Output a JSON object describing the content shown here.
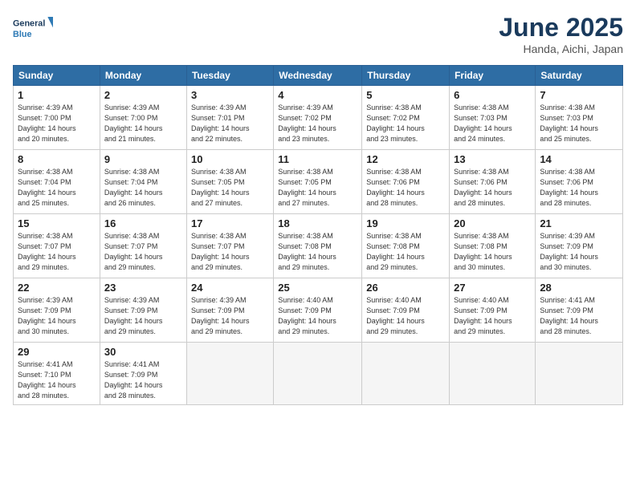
{
  "logo": {
    "line1": "General",
    "line2": "Blue"
  },
  "title": "June 2025",
  "location": "Handa, Aichi, Japan",
  "weekdays": [
    "Sunday",
    "Monday",
    "Tuesday",
    "Wednesday",
    "Thursday",
    "Friday",
    "Saturday"
  ],
  "weeks": [
    [
      {
        "day": "1",
        "info": "Sunrise: 4:39 AM\nSunset: 7:00 PM\nDaylight: 14 hours\nand 20 minutes."
      },
      {
        "day": "2",
        "info": "Sunrise: 4:39 AM\nSunset: 7:00 PM\nDaylight: 14 hours\nand 21 minutes."
      },
      {
        "day": "3",
        "info": "Sunrise: 4:39 AM\nSunset: 7:01 PM\nDaylight: 14 hours\nand 22 minutes."
      },
      {
        "day": "4",
        "info": "Sunrise: 4:39 AM\nSunset: 7:02 PM\nDaylight: 14 hours\nand 23 minutes."
      },
      {
        "day": "5",
        "info": "Sunrise: 4:38 AM\nSunset: 7:02 PM\nDaylight: 14 hours\nand 23 minutes."
      },
      {
        "day": "6",
        "info": "Sunrise: 4:38 AM\nSunset: 7:03 PM\nDaylight: 14 hours\nand 24 minutes."
      },
      {
        "day": "7",
        "info": "Sunrise: 4:38 AM\nSunset: 7:03 PM\nDaylight: 14 hours\nand 25 minutes."
      }
    ],
    [
      {
        "day": "8",
        "info": "Sunrise: 4:38 AM\nSunset: 7:04 PM\nDaylight: 14 hours\nand 25 minutes."
      },
      {
        "day": "9",
        "info": "Sunrise: 4:38 AM\nSunset: 7:04 PM\nDaylight: 14 hours\nand 26 minutes."
      },
      {
        "day": "10",
        "info": "Sunrise: 4:38 AM\nSunset: 7:05 PM\nDaylight: 14 hours\nand 27 minutes."
      },
      {
        "day": "11",
        "info": "Sunrise: 4:38 AM\nSunset: 7:05 PM\nDaylight: 14 hours\nand 27 minutes."
      },
      {
        "day": "12",
        "info": "Sunrise: 4:38 AM\nSunset: 7:06 PM\nDaylight: 14 hours\nand 28 minutes."
      },
      {
        "day": "13",
        "info": "Sunrise: 4:38 AM\nSunset: 7:06 PM\nDaylight: 14 hours\nand 28 minutes."
      },
      {
        "day": "14",
        "info": "Sunrise: 4:38 AM\nSunset: 7:06 PM\nDaylight: 14 hours\nand 28 minutes."
      }
    ],
    [
      {
        "day": "15",
        "info": "Sunrise: 4:38 AM\nSunset: 7:07 PM\nDaylight: 14 hours\nand 29 minutes."
      },
      {
        "day": "16",
        "info": "Sunrise: 4:38 AM\nSunset: 7:07 PM\nDaylight: 14 hours\nand 29 minutes."
      },
      {
        "day": "17",
        "info": "Sunrise: 4:38 AM\nSunset: 7:07 PM\nDaylight: 14 hours\nand 29 minutes."
      },
      {
        "day": "18",
        "info": "Sunrise: 4:38 AM\nSunset: 7:08 PM\nDaylight: 14 hours\nand 29 minutes."
      },
      {
        "day": "19",
        "info": "Sunrise: 4:38 AM\nSunset: 7:08 PM\nDaylight: 14 hours\nand 29 minutes."
      },
      {
        "day": "20",
        "info": "Sunrise: 4:38 AM\nSunset: 7:08 PM\nDaylight: 14 hours\nand 30 minutes."
      },
      {
        "day": "21",
        "info": "Sunrise: 4:39 AM\nSunset: 7:09 PM\nDaylight: 14 hours\nand 30 minutes."
      }
    ],
    [
      {
        "day": "22",
        "info": "Sunrise: 4:39 AM\nSunset: 7:09 PM\nDaylight: 14 hours\nand 30 minutes."
      },
      {
        "day": "23",
        "info": "Sunrise: 4:39 AM\nSunset: 7:09 PM\nDaylight: 14 hours\nand 29 minutes."
      },
      {
        "day": "24",
        "info": "Sunrise: 4:39 AM\nSunset: 7:09 PM\nDaylight: 14 hours\nand 29 minutes."
      },
      {
        "day": "25",
        "info": "Sunrise: 4:40 AM\nSunset: 7:09 PM\nDaylight: 14 hours\nand 29 minutes."
      },
      {
        "day": "26",
        "info": "Sunrise: 4:40 AM\nSunset: 7:09 PM\nDaylight: 14 hours\nand 29 minutes."
      },
      {
        "day": "27",
        "info": "Sunrise: 4:40 AM\nSunset: 7:09 PM\nDaylight: 14 hours\nand 29 minutes."
      },
      {
        "day": "28",
        "info": "Sunrise: 4:41 AM\nSunset: 7:09 PM\nDaylight: 14 hours\nand 28 minutes."
      }
    ],
    [
      {
        "day": "29",
        "info": "Sunrise: 4:41 AM\nSunset: 7:10 PM\nDaylight: 14 hours\nand 28 minutes."
      },
      {
        "day": "30",
        "info": "Sunrise: 4:41 AM\nSunset: 7:09 PM\nDaylight: 14 hours\nand 28 minutes."
      },
      {
        "day": "",
        "info": ""
      },
      {
        "day": "",
        "info": ""
      },
      {
        "day": "",
        "info": ""
      },
      {
        "day": "",
        "info": ""
      },
      {
        "day": "",
        "info": ""
      }
    ]
  ]
}
